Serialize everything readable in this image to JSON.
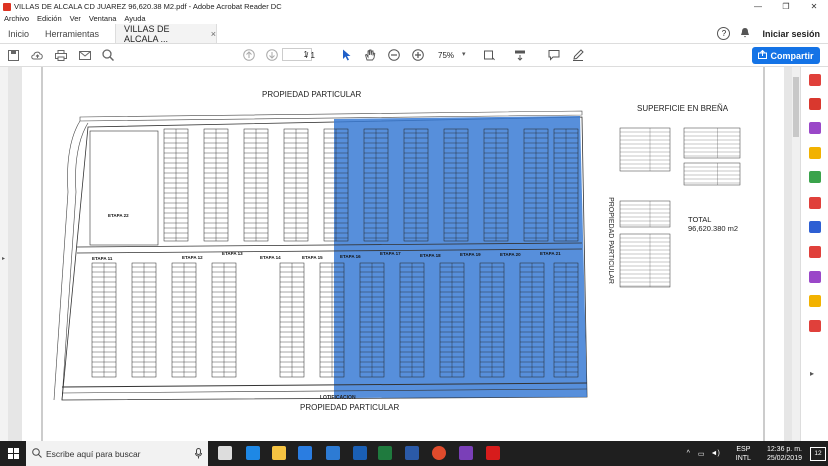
{
  "window": {
    "title": "VILLAS DE ALCALA CD JUAREZ  96,620.38 M2.pdf - Adobe Acrobat Reader DC",
    "controls": [
      "—",
      "❐",
      "✕"
    ]
  },
  "menu": [
    "Archivo",
    "Edición",
    "Ver",
    "Ventana",
    "Ayuda"
  ],
  "tabs": {
    "home": "Inicio",
    "tools": "Herramientas",
    "document": "VILLAS DE ALCALA ...",
    "close": "×"
  },
  "account": {
    "help": "?",
    "signin": "Iniciar sesión"
  },
  "toolbar": {
    "page_current": "1",
    "page_total": "/  1",
    "zoom": "75%",
    "share_label": "Compartir"
  },
  "document": {
    "top_label": "PROPIEDAD PARTICULAR",
    "bottom_label": "PROPIEDAD PARTICULAR",
    "lotificacion": "LOTIFICACION",
    "side_label": "PROPIEDAD PARTICULAR",
    "superficie_title": "SUPERFICIE EN BREÑA",
    "total_label": "TOTAL",
    "total_value": "96,620.380 m2",
    "etapa_labels": [
      "ETAPA 22",
      "ETAPA 11",
      "ETAPA 12",
      "ETAPA 13",
      "ETAPA 14",
      "ETAPA 15",
      "ETAPA 16",
      "ETAPA 17",
      "ETAPA 18",
      "ETAPA 19",
      "ETAPA 20",
      "ETAPA 21"
    ],
    "highlight_color": "#3a7bd5"
  },
  "taskbar": {
    "search_placeholder": "Escribe aquí para buscar",
    "lang": "ESP",
    "lang2": "INTL",
    "time": "12:36 p. m.",
    "date": "25/02/2019",
    "notifications": "12"
  }
}
